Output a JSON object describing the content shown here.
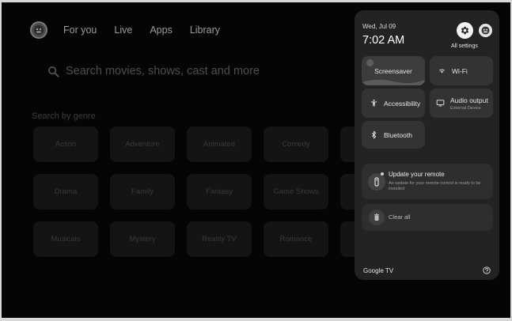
{
  "nav": {
    "tabs": [
      {
        "label": "For you"
      },
      {
        "label": "Live"
      },
      {
        "label": "Apps"
      },
      {
        "label": "Library"
      }
    ]
  },
  "search": {
    "placeholder": "Search movies, shows, cast and more",
    "icon": "search-icon"
  },
  "genres": {
    "heading": "Search by genre",
    "items": [
      "Action",
      "Adventure",
      "Animated",
      "Comedy",
      "",
      "Drama",
      "Family",
      "Fantasy",
      "Game Shows",
      "",
      "Musicals",
      "Mystery",
      "Reality TV",
      "Romance",
      ""
    ]
  },
  "quick_settings": {
    "date": "Wed, Jul 09",
    "time": "7:02 AM",
    "all_settings_label": "All settings",
    "tiles": {
      "screensaver": "Screensaver",
      "wifi": "Wi-Fi",
      "accessibility": "Accessibility",
      "audio_output": "Audio output",
      "audio_output_sub": "External Device",
      "bluetooth": "Bluetooth"
    },
    "notification": {
      "title": "Update your remote",
      "body": "An update for your remote control is ready to be installed"
    },
    "clear_all": "Clear all",
    "brand": "Google TV"
  }
}
